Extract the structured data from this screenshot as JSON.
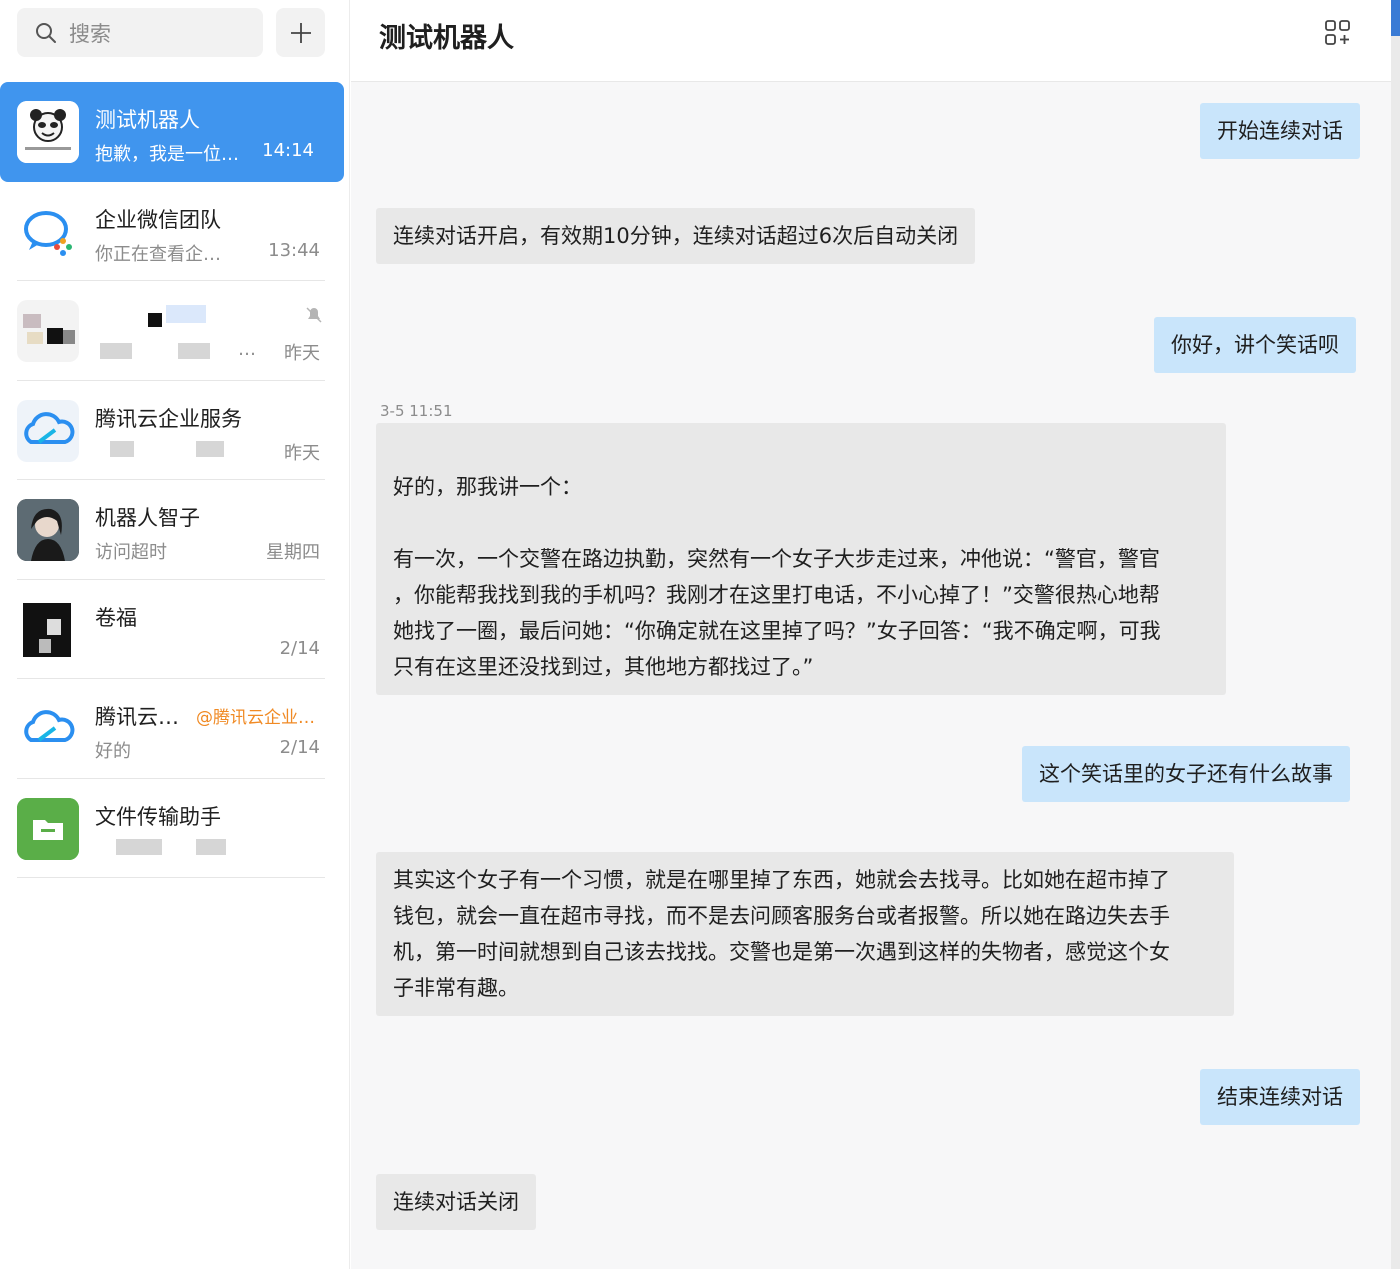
{
  "sidebar": {
    "search_placeholder": "搜索",
    "chats": [
      {
        "name": "测试机器人",
        "preview": "抱歉，我是一位…",
        "time": "14:14",
        "avatar_icon": "panda-meme-avatar",
        "active": true
      },
      {
        "name": "企业微信团队",
        "preview": "你正在查看企…",
        "time": "13:44",
        "avatar_icon": "wecom-logo-avatar"
      },
      {
        "name": "",
        "preview": "…",
        "time": "昨天",
        "avatar_icon": "blurred-avatar",
        "muted": true
      },
      {
        "name": "腾讯云企业服务",
        "preview": "",
        "time": "昨天",
        "avatar_icon": "tencent-cloud-avatar"
      },
      {
        "name": "机器人智子",
        "preview": "访问超时",
        "time": "星期四",
        "avatar_icon": "portrait-avatar"
      },
      {
        "name": "卷福",
        "preview": "",
        "time": "2/14",
        "avatar_icon": "blurred-avatar"
      },
      {
        "name": "腾讯云…",
        "mention": "@腾讯云企业…",
        "preview": "好的",
        "time": "2/14",
        "avatar_icon": "tencent-cloud-avatar"
      },
      {
        "name": "文件传输助手",
        "preview": "",
        "time": "",
        "avatar_icon": "folder-avatar"
      }
    ]
  },
  "header": {
    "title": "测试机器人"
  },
  "messages": {
    "m1": "开始连续对话",
    "m2": "连续对话开启，有效期10分钟，连续对话超过6次后自动关闭",
    "m3": "你好，讲个笑话呗",
    "ts": "3-5 11:51",
    "m4_l1": "好的，那我讲一个：",
    "m4_l2": "有一次，一个交警在路边执勤，突然有一个女子大步走过来，冲他说：“警官，警官",
    "m4_l3": "，你能帮我找到我的手机吗？我刚才在这里打电话，不小心掉了！”交警很热心地帮",
    "m4_l4": "她找了一圈，最后问她：“你确定就在这里掉了吗？”女子回答：“我不确定啊，可我",
    "m4_l5": "只有在这里还没找到过，其他地方都找过了。”",
    "m5": "这个笑话里的女子还有什么故事",
    "m6_l1": "其实这个女子有一个习惯，就是在哪里掉了东西，她就会去找寻。比如她在超市掉了",
    "m6_l2": "钱包，就会一直在超市寻找，而不是去问顾客服务台或者报警。所以她在路边失去手",
    "m6_l3": "机，第一时间就想到自己该去找找。交警也是第一次遇到这样的失物者，感觉这个女",
    "m6_l4": "子非常有趣。",
    "m7": "结束连续对话",
    "m8": "连续对话关闭"
  },
  "colors": {
    "active": "#4095ee",
    "me_bubble": "#c9e5fb",
    "bot_bubble": "#e8e8e8"
  }
}
